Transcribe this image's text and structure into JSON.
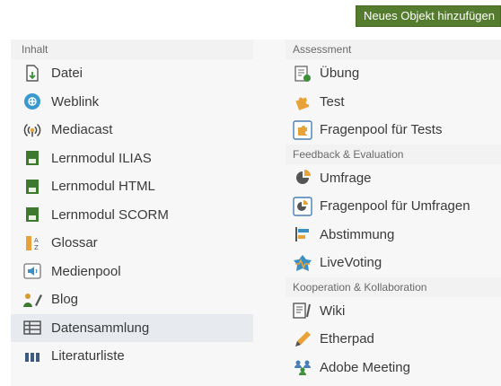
{
  "header": {
    "add_button_label": "Neues Objekt hinzufügen"
  },
  "menu": {
    "left": {
      "group_title": "Inhalt",
      "items": [
        {
          "label": "Datei",
          "icon": "file-download-icon"
        },
        {
          "label": "Weblink",
          "icon": "weblink-icon"
        },
        {
          "label": "Mediacast",
          "icon": "mediacast-icon"
        },
        {
          "label": "Lernmodul ILIAS",
          "icon": "learning-module-icon"
        },
        {
          "label": "Lernmodul HTML",
          "icon": "learning-module-icon"
        },
        {
          "label": "Lernmodul SCORM",
          "icon": "learning-module-icon"
        },
        {
          "label": "Glossar",
          "icon": "glossary-icon"
        },
        {
          "label": "Medienpool",
          "icon": "media-pool-icon"
        },
        {
          "label": "Blog",
          "icon": "blog-icon"
        },
        {
          "label": "Datensammlung",
          "icon": "data-collection-icon",
          "active": true
        },
        {
          "label": "Literaturliste",
          "icon": "bibliography-icon"
        }
      ]
    },
    "right": {
      "groups": [
        {
          "title": "Assessment",
          "items": [
            {
              "label": "Übung",
              "icon": "exercise-icon"
            },
            {
              "label": "Test",
              "icon": "test-puzzle-icon"
            },
            {
              "label": "Fragenpool für Tests",
              "icon": "question-pool-icon"
            }
          ]
        },
        {
          "title": "Feedback & Evaluation",
          "items": [
            {
              "label": "Umfrage",
              "icon": "survey-icon"
            },
            {
              "label": "Fragenpool für Umfragen",
              "icon": "survey-pool-icon"
            },
            {
              "label": "Abstimmung",
              "icon": "poll-icon"
            },
            {
              "label": "LiveVoting",
              "icon": "livevoting-icon"
            }
          ]
        },
        {
          "title": "Kooperation & Kollaboration",
          "items": [
            {
              "label": "Wiki",
              "icon": "wiki-icon"
            },
            {
              "label": "Etherpad",
              "icon": "etherpad-pencil-icon"
            },
            {
              "label": "Adobe Meeting",
              "icon": "adobe-meeting-icon"
            }
          ]
        }
      ]
    }
  },
  "colors": {
    "add_button_bg": "#557b2e",
    "learning_module_green": "#3d7a2f",
    "icon_orange": "#e8a23a",
    "icon_blue": "#3a8fc4"
  }
}
